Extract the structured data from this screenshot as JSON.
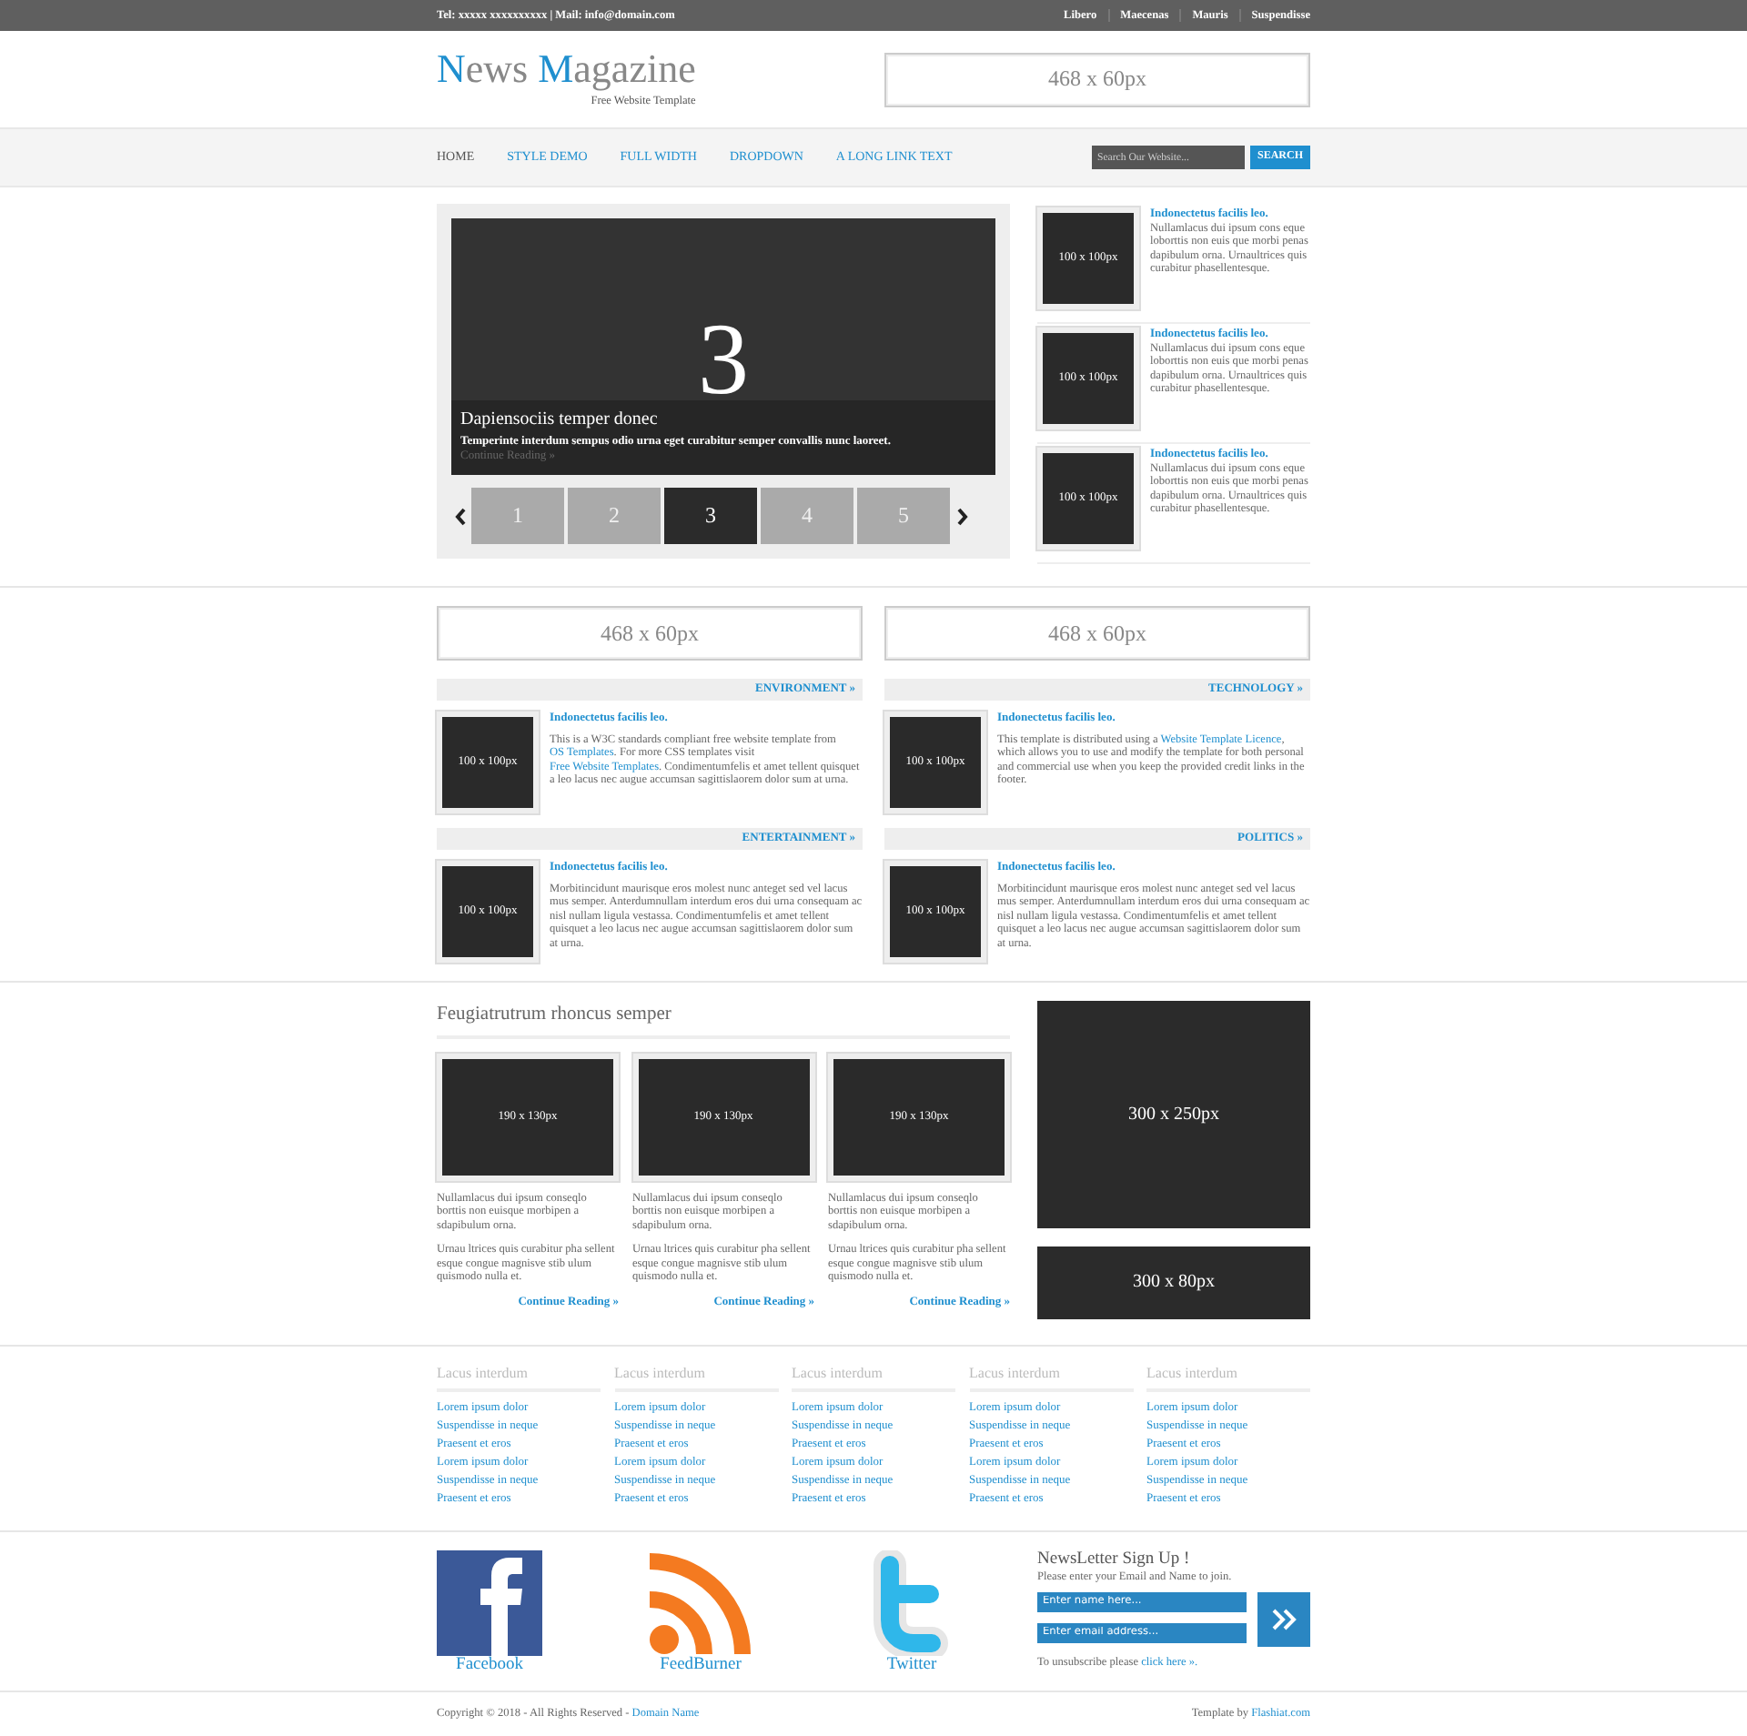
{
  "top_bar": {
    "contact": "Tel: xxxxx xxxxxxxxxx | Mail: info@domain.com",
    "links": [
      "Libero",
      "Maecenas",
      "Mauris",
      "Suspendisse"
    ]
  },
  "logo": {
    "parts": [
      {
        "text": "N",
        "accent": true
      },
      {
        "text": "ews ",
        "accent": false
      },
      {
        "text": "M",
        "accent": true
      },
      {
        "text": "agazine",
        "accent": false
      }
    ],
    "tagline": "Free Website Template"
  },
  "header_banner": "468 x 60px",
  "nav": {
    "items": [
      {
        "label": "HOME",
        "selected": true
      },
      {
        "label": "STYLE DEMO",
        "selected": false
      },
      {
        "label": "FULL WIDTH",
        "selected": false
      },
      {
        "label": "DROPDOWN",
        "selected": false
      },
      {
        "label": "A LONG LINK TEXT",
        "selected": false
      }
    ],
    "search": {
      "placeholder": "Search Our Website...",
      "button": "SEARCH"
    }
  },
  "slider": {
    "number": "3",
    "title": "Dapiensociis temper donec",
    "text": "Temperinte interdum sempus odio urna eget curabitur semper convallis nunc laoreet.",
    "link": "Continue Reading »",
    "pages": [
      {
        "label": "1",
        "selected": false
      },
      {
        "label": "2",
        "selected": false
      },
      {
        "label": "3",
        "selected": true
      },
      {
        "label": "4",
        "selected": false
      },
      {
        "label": "5",
        "selected": false
      }
    ]
  },
  "side_posts": [
    {
      "thumb": "100 x 100px",
      "title": "Indonectetus facilis leo.",
      "text": "Nullamlacus dui ipsum cons eque loborttis non euis que morbi penas dapibulum orna. Urnaultrices quis curabitur phasellentesque."
    },
    {
      "thumb": "100 x 100px",
      "title": "Indonectetus facilis leo.",
      "text": "Nullamlacus dui ipsum cons eque loborttis non euis que morbi penas dapibulum orna. Urnaultrices quis curabitur phasellentesque."
    },
    {
      "thumb": "100 x 100px",
      "title": "Indonectetus facilis leo.",
      "text": "Nullamlacus dui ipsum cons eque loborttis non euis que morbi penas dapibulum orna. Urnaultrices quis curabitur phasellentesque."
    }
  ],
  "banners": [
    "468 x 60px",
    "468 x 60px"
  ],
  "categories": [
    {
      "heading": "ENVIRONMENT »",
      "thumb": "100 x 100px",
      "title": "Indonectetus facilis leo.",
      "text": [
        {
          "text": "This is a W3C standards compliant free website template from ",
          "link": false
        },
        {
          "text": "OS Templates",
          "link": true
        },
        {
          "text": ". For more CSS templates visit ",
          "link": false
        },
        {
          "text": "Free Website Templates",
          "link": true
        },
        {
          "text": ". Condimentumfelis et amet tellent quisquet a leo lacus nec augue accumsan sagittislaorem dolor sum at urna.",
          "link": false
        }
      ]
    },
    {
      "heading": "TECHNOLOGY »",
      "thumb": "100 x 100px",
      "title": "Indonectetus facilis leo.",
      "text": [
        {
          "text": "This template is distributed using a ",
          "link": false
        },
        {
          "text": "Website Template Licence",
          "link": true
        },
        {
          "text": ", which allows you to use and modify the template for both personal and commercial use when you keep the provided credit links in the footer.",
          "link": false
        }
      ]
    },
    {
      "heading": "ENTERTAINMENT »",
      "thumb": "100 x 100px",
      "title": "Indonectetus facilis leo.",
      "text": [
        {
          "text": "Morbitincidunt maurisque eros molest nunc anteget sed vel lacus mus semper. Anterdumnullam interdum eros dui urna consequam ac nisl nullam ligula vestassa. Condimentumfelis et amet tellent quisquet a leo lacus nec augue accumsan sagittislaorem dolor sum at urna.",
          "link": false
        }
      ]
    },
    {
      "heading": "POLITICS »",
      "thumb": "100 x 100px",
      "title": "Indonectetus facilis leo.",
      "text": [
        {
          "text": "Morbitincidunt maurisque eros molest nunc anteget sed vel lacus mus semper. Anterdumnullam interdum eros dui urna consequam ac nisl nullam ligula vestassa. Condimentumfelis et amet tellent quisquet a leo lacus nec augue accumsan sagittislaorem dolor sum at urna.",
          "link": false
        }
      ]
    }
  ],
  "featured": {
    "heading": "Feugiatrutrum rhoncus semper",
    "items": [
      {
        "thumb": "190 x 130px",
        "paragraphs": [
          "Nullamlacus dui ipsum conseqlo borttis non euisque morbipen a sdapibulum orna.",
          "Urnau ltrices quis curabitur pha sellent esque congue magnisve stib ulum quismodo nulla et."
        ],
        "link": "Continue Reading »"
      },
      {
        "thumb": "190 x 130px",
        "paragraphs": [
          "Nullamlacus dui ipsum conseqlo borttis non euisque morbipen a sdapibulum orna.",
          "Urnau ltrices quis curabitur pha sellent esque congue magnisve stib ulum quismodo nulla et."
        ],
        "link": "Continue Reading »"
      },
      {
        "thumb": "190 x 130px",
        "paragraphs": [
          "Nullamlacus dui ipsum conseqlo borttis non euisque morbipen a sdapibulum orna.",
          "Urnau ltrices quis curabitur pha sellent esque congue magnisve stib ulum quismodo nulla et."
        ],
        "link": "Continue Reading »"
      }
    ]
  },
  "ads": [
    "300 x 250px",
    "300 x 80px"
  ],
  "footer_columns": [
    {
      "heading": "Lacus interdum",
      "links": [
        "Lorem ipsum dolor",
        "Suspendisse in neque",
        "Praesent et eros",
        "Lorem ipsum dolor",
        "Suspendisse in neque",
        "Praesent et eros"
      ]
    },
    {
      "heading": "Lacus interdum",
      "links": [
        "Lorem ipsum dolor",
        "Suspendisse in neque",
        "Praesent et eros",
        "Lorem ipsum dolor",
        "Suspendisse in neque",
        "Praesent et eros"
      ]
    },
    {
      "heading": "Lacus interdum",
      "links": [
        "Lorem ipsum dolor",
        "Suspendisse in neque",
        "Praesent et eros",
        "Lorem ipsum dolor",
        "Suspendisse in neque",
        "Praesent et eros"
      ]
    },
    {
      "heading": "Lacus interdum",
      "links": [
        "Lorem ipsum dolor",
        "Suspendisse in neque",
        "Praesent et eros",
        "Lorem ipsum dolor",
        "Suspendisse in neque",
        "Praesent et eros"
      ]
    },
    {
      "heading": "Lacus interdum",
      "links": [
        "Lorem ipsum dolor",
        "Suspendisse in neque",
        "Praesent et eros",
        "Lorem ipsum dolor",
        "Suspendisse in neque",
        "Praesent et eros"
      ]
    }
  ],
  "social": [
    {
      "kind": "facebook",
      "label": "Facebook"
    },
    {
      "kind": "rss",
      "label": "FeedBurner"
    },
    {
      "kind": "twitter",
      "label": "Twitter"
    }
  ],
  "newsletter": {
    "title": "NewsLetter Sign Up !",
    "subtitle": "Please enter your Email and Name to join.",
    "name_placeholder": "Enter name here...",
    "email_placeholder": "Enter email address...",
    "note": "To unsubscribe please ",
    "note_link": "click here »."
  },
  "copyright": {
    "text": "Copyright © 2018 - All Rights Reserved - ",
    "link": "Domain Name"
  },
  "credit": {
    "text": "Template by ",
    "link": "Flashiat.com"
  }
}
